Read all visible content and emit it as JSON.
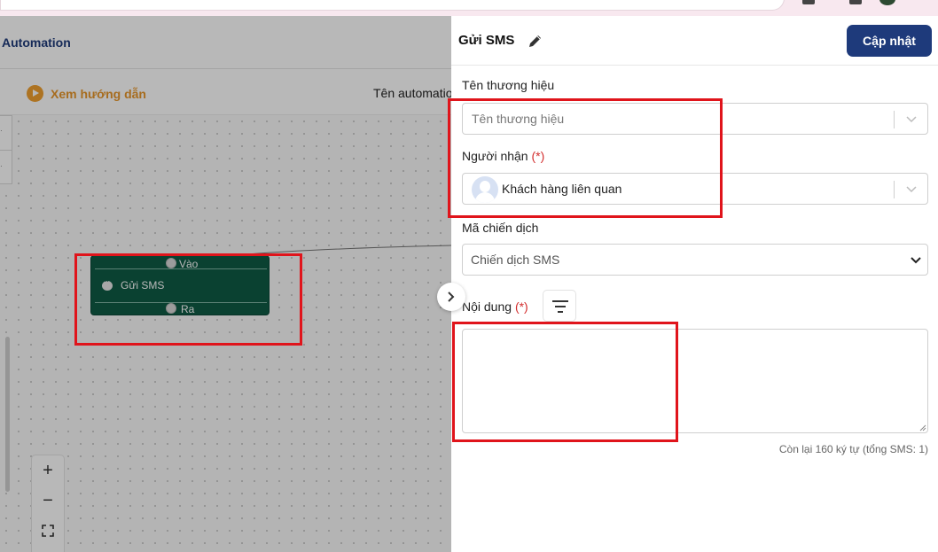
{
  "app": {
    "title": "Automation",
    "guide_label": "Xem hướng dẫn",
    "automation_name_label": "Tên automation"
  },
  "canvas": {
    "node": {
      "title": "Gửi SMS",
      "in_label": "Vào",
      "out_label": "Ra",
      "icon": "chat-bubble-icon"
    },
    "zoom_controls": {
      "zoom_in": "+",
      "zoom_out": "−"
    }
  },
  "panel": {
    "title": "Gửi SMS",
    "update_label": "Cập nhật",
    "brand": {
      "label": "Tên thương hiệu",
      "placeholder": "Tên thương hiệu"
    },
    "recipient": {
      "label": "Người nhận",
      "required": "(*)",
      "value": "Khách hàng liên quan"
    },
    "campaign": {
      "label": "Mã chiến dịch",
      "value": "Chiến dịch SMS"
    },
    "content": {
      "label": "Nội dung",
      "required": "(*)",
      "value": "",
      "char_count": "Còn lại 160 ký tự (tổng SMS: 1)"
    }
  },
  "colors": {
    "primary": "#1e3a7b",
    "node": "#0f5a45",
    "guide": "#e8962a",
    "highlight": "#e0141b",
    "required": "#d32f2f"
  }
}
